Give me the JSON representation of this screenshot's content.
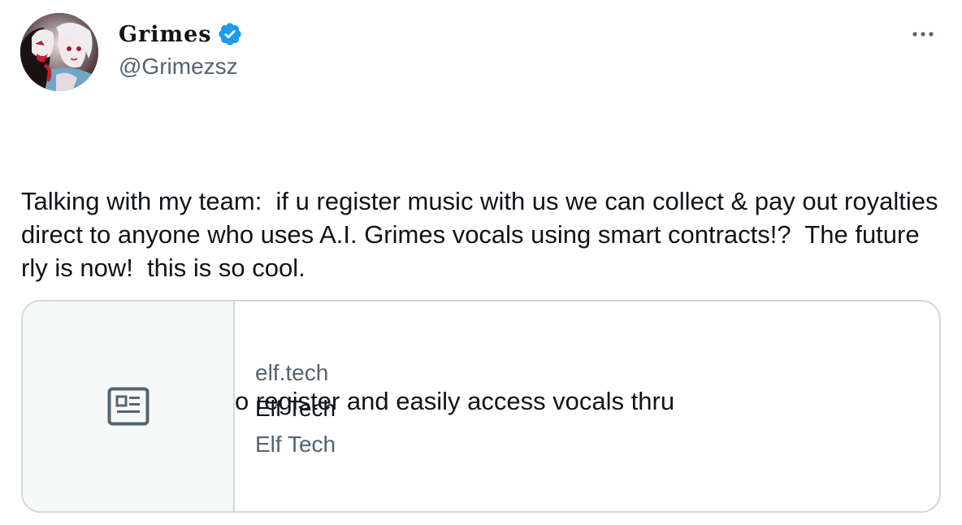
{
  "author": {
    "display_name": "Grimes",
    "handle": "@Grimezsz",
    "avatar_icon": "avatar-image",
    "verified_icon": "verified-badge-icon",
    "verified_color": "#1d9bf0"
  },
  "menu": {
    "icon": "more-options-icon"
  },
  "tweet": {
    "paragraph_1": "Talking with my team:  if u register music with us we can collect & pay out royalties direct to anyone who uses A.I. Grimes vocals using smart contracts!?  The future rly is now!  this is so cool.",
    "paragraph_2": "Working on a way to register and easily access vocals thru"
  },
  "link_card": {
    "icon": "newspaper-icon",
    "domain": "elf.tech",
    "title": "Elf Tech",
    "description": "Elf Tech"
  },
  "colors": {
    "text_primary": "#0f1419",
    "text_secondary": "#536471",
    "border": "#cfd9de",
    "card_thumb_bg": "#f7f9f9"
  }
}
